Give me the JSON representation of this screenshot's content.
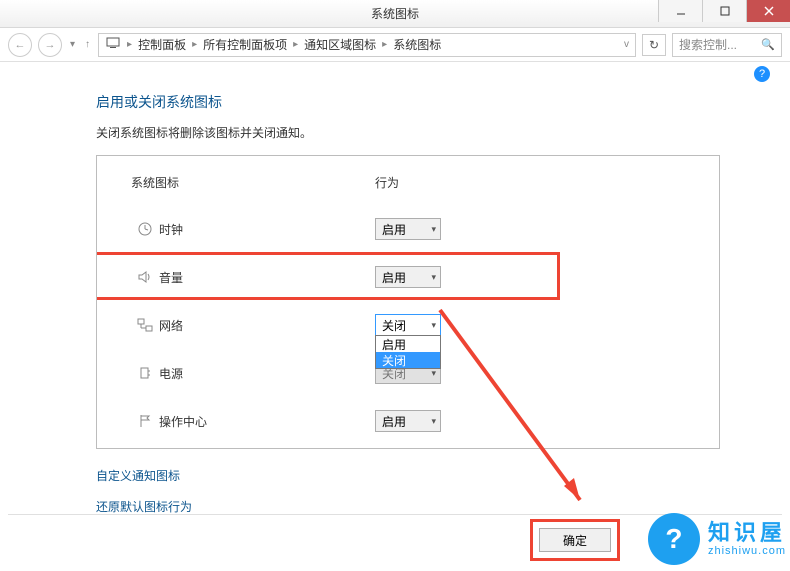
{
  "window": {
    "title": "系统图标"
  },
  "nav": {
    "back": "←",
    "forward": "→",
    "up": "↑",
    "refresh": "↻"
  },
  "breadcrumb": {
    "root_icon": "computer-icon",
    "items": [
      "控制面板",
      "所有控制面板项",
      "通知区域图标",
      "系统图标"
    ]
  },
  "search": {
    "placeholder": "搜索控制..."
  },
  "page": {
    "heading": "启用或关闭系统图标",
    "subtext": "关闭系统图标将删除该图标并关闭通知。"
  },
  "columns": {
    "icon_col": "系统图标",
    "behavior_col": "行为"
  },
  "rows": [
    {
      "icon": "clock-icon",
      "label": "时钟",
      "value": "启用",
      "open": false
    },
    {
      "icon": "volume-icon",
      "label": "音量",
      "value": "启用",
      "open": false
    },
    {
      "icon": "network-icon",
      "label": "网络",
      "value": "关闭",
      "open": true
    },
    {
      "icon": "power-icon",
      "label": "电源",
      "value": "关闭",
      "open": false,
      "disabled": true
    },
    {
      "icon": "flag-icon",
      "label": "操作中心",
      "value": "启用",
      "open": false
    }
  ],
  "dropdown_options": [
    "启用",
    "关闭"
  ],
  "links": {
    "customize": "自定义通知图标",
    "restore": "还原默认图标行为"
  },
  "buttons": {
    "ok": "确定"
  },
  "watermark": {
    "cn": "知识屋",
    "en": "zhishiwu.com",
    "glyph": "?"
  }
}
